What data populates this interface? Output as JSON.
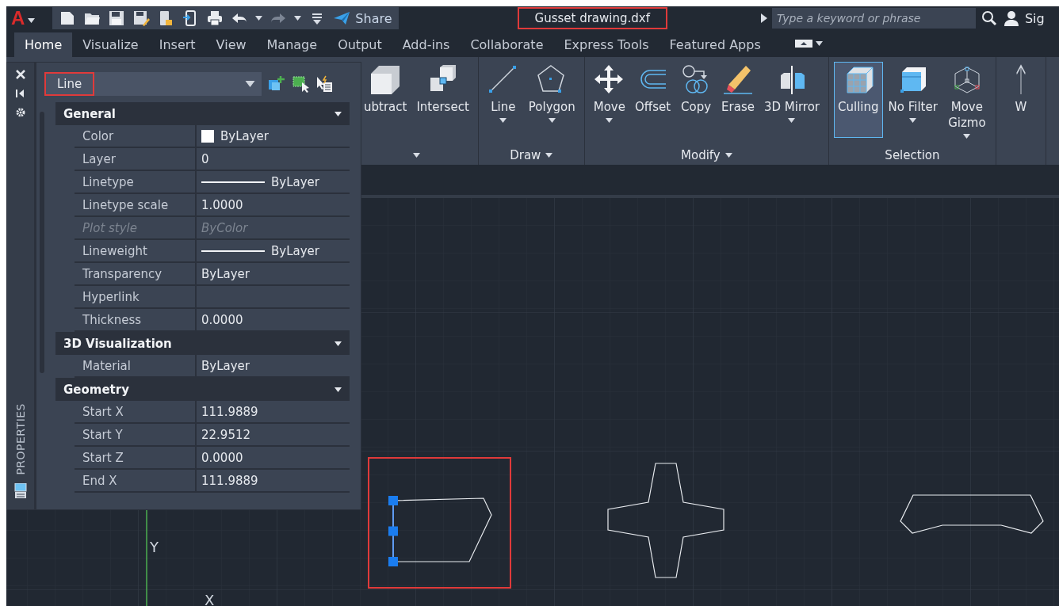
{
  "app": {
    "logo": "A"
  },
  "quick_access": {
    "share": "Share"
  },
  "title": {
    "text": "Gusset drawing.dxf",
    "highlighted": true
  },
  "search": {
    "placeholder": "Type a keyword or phrase"
  },
  "account": {
    "label": "Sig"
  },
  "ribbon_tabs": [
    {
      "label": "Home",
      "selected": true
    },
    {
      "label": "Visualize",
      "selected": false
    },
    {
      "label": "Insert",
      "selected": false
    },
    {
      "label": "View",
      "selected": false
    },
    {
      "label": "Manage",
      "selected": false
    },
    {
      "label": "Output",
      "selected": false
    },
    {
      "label": "Add-ins",
      "selected": false
    },
    {
      "label": "Collaborate",
      "selected": false
    },
    {
      "label": "Express Tools",
      "selected": false
    },
    {
      "label": "Featured Apps",
      "selected": false
    }
  ],
  "ribbon_panels": [
    {
      "menu": true,
      "buttons": [
        {
          "label": "ubtract",
          "kind": "subtract",
          "dropdown": false,
          "selected": false
        },
        {
          "label": "Intersect",
          "kind": "intersect",
          "dropdown": false,
          "selected": false
        }
      ]
    },
    {
      "title": "Draw",
      "menu": true,
      "buttons": [
        {
          "label": "Line",
          "kind": "line",
          "dropdown": true,
          "selected": false
        },
        {
          "label": "Polygon",
          "kind": "polygon",
          "dropdown": true,
          "selected": false
        }
      ]
    },
    {
      "title": "Modify",
      "menu": true,
      "buttons": [
        {
          "label": "Move",
          "kind": "move",
          "dropdown": true,
          "selected": false
        },
        {
          "label": "Offset",
          "kind": "offset",
          "dropdown": false,
          "selected": false
        },
        {
          "label": "Copy",
          "kind": "copy",
          "dropdown": false,
          "selected": false
        },
        {
          "label": "Erase",
          "kind": "erase",
          "dropdown": false,
          "selected": false
        },
        {
          "label": "3D Mirror",
          "kind": "mirror",
          "dropdown": true,
          "selected": false
        }
      ]
    },
    {
      "title": "Selection",
      "menu": false,
      "buttons": [
        {
          "label": "Culling",
          "kind": "culling",
          "dropdown": false,
          "selected": true
        },
        {
          "label": "No Filter",
          "kind": "nofilter",
          "dropdown": true,
          "selected": false
        },
        {
          "label": "Move Gizmo",
          "kind": "gizmo",
          "dropdown": true,
          "selected": false
        }
      ]
    },
    {
      "buttons": [
        {
          "label": "W",
          "kind": "arrow",
          "dropdown": false,
          "selected": false
        }
      ]
    }
  ],
  "properties": {
    "side_label": "PROPERTIES",
    "object_type": "Line",
    "highlighted": true,
    "sections": [
      {
        "title": "General",
        "expanded": true,
        "rows": [
          {
            "name": "Color",
            "value": "ByLayer",
            "kind": "swatch",
            "disabled": false
          },
          {
            "name": "Layer",
            "value": "0",
            "kind": "text",
            "disabled": false
          },
          {
            "name": "Linetype",
            "value": "ByLayer",
            "kind": "line",
            "disabled": false
          },
          {
            "name": "Linetype scale",
            "value": "1.0000",
            "kind": "text",
            "disabled": false
          },
          {
            "name": "Plot style",
            "value": "ByColor",
            "kind": "text",
            "disabled": true
          },
          {
            "name": "Lineweight",
            "value": "ByLayer",
            "kind": "line",
            "disabled": false
          },
          {
            "name": "Transparency",
            "value": "ByLayer",
            "kind": "text",
            "disabled": false
          },
          {
            "name": "Hyperlink",
            "kind": "text",
            "disabled": false
          },
          {
            "name": "Thickness",
            "value": "0.0000",
            "kind": "text",
            "disabled": false
          }
        ]
      },
      {
        "title": "3D Visualization",
        "expanded": true,
        "rows": [
          {
            "name": "Material",
            "value": "ByLayer",
            "kind": "text",
            "disabled": false
          }
        ]
      },
      {
        "title": "Geometry",
        "expanded": true,
        "rows": [
          {
            "name": "Start X",
            "value": "111.9889",
            "kind": "text",
            "disabled": false
          },
          {
            "name": "Start Y",
            "value": "22.9512",
            "kind": "text",
            "disabled": false
          },
          {
            "name": "Start Z",
            "value": "0.0000",
            "kind": "text",
            "disabled": false
          },
          {
            "name": "End X",
            "value": "111.9889",
            "kind": "text",
            "disabled": false
          }
        ]
      }
    ]
  },
  "canvas": {
    "ucs": {
      "y_label": "Y",
      "x_label": "X"
    },
    "shapes": [
      {
        "kind": "tab",
        "selected": true,
        "highlighted": true
      },
      {
        "kind": "cross",
        "selected": false,
        "highlighted": false
      },
      {
        "kind": "bar",
        "selected": false,
        "highlighted": false
      }
    ]
  }
}
